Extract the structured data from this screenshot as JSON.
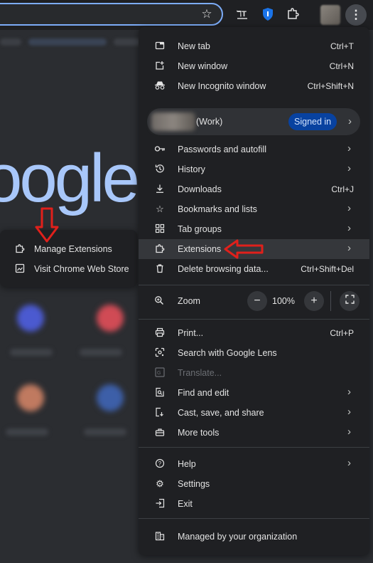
{
  "toolbar": {
    "icons": [
      "star-icon",
      "translate-icon",
      "bitwarden-shield-icon",
      "extensions-puzzle-icon",
      "profile-avatar",
      "more-menu-icon"
    ]
  },
  "page": {
    "logo_text": "oogle"
  },
  "menu": {
    "new_tab": {
      "label": "New tab",
      "shortcut": "Ctrl+T"
    },
    "new_window": {
      "label": "New window",
      "shortcut": "Ctrl+N"
    },
    "new_incognito": {
      "label": "New Incognito window",
      "shortcut": "Ctrl+Shift+N"
    },
    "profile": {
      "name": "(Work)",
      "status": "Signed in"
    },
    "passwords": {
      "label": "Passwords and autofill"
    },
    "history": {
      "label": "History"
    },
    "downloads": {
      "label": "Downloads",
      "shortcut": "Ctrl+J"
    },
    "bookmarks": {
      "label": "Bookmarks and lists"
    },
    "tab_groups": {
      "label": "Tab groups"
    },
    "extensions": {
      "label": "Extensions"
    },
    "delete_data": {
      "label": "Delete browsing data...",
      "shortcut": "Ctrl+Shift+Del"
    },
    "zoom": {
      "label": "Zoom",
      "value": "100%",
      "minus": "−",
      "plus": "+"
    },
    "print": {
      "label": "Print...",
      "shortcut": "Ctrl+P"
    },
    "lens": {
      "label": "Search with Google Lens"
    },
    "translate": {
      "label": "Translate..."
    },
    "find_edit": {
      "label": "Find and edit"
    },
    "cast_save": {
      "label": "Cast, save, and share"
    },
    "more_tools": {
      "label": "More tools"
    },
    "help": {
      "label": "Help"
    },
    "settings": {
      "label": "Settings"
    },
    "exit": {
      "label": "Exit"
    },
    "managed": {
      "label": "Managed by your organization"
    }
  },
  "submenu": {
    "manage_extensions": {
      "label": "Manage Extensions"
    },
    "web_store": {
      "label": "Visit Chrome Web Store"
    }
  },
  "colors": {
    "accent": "#a8c7fa",
    "annotation_arrow": "#e0201b",
    "signed_in_badge": "#0842a0"
  }
}
